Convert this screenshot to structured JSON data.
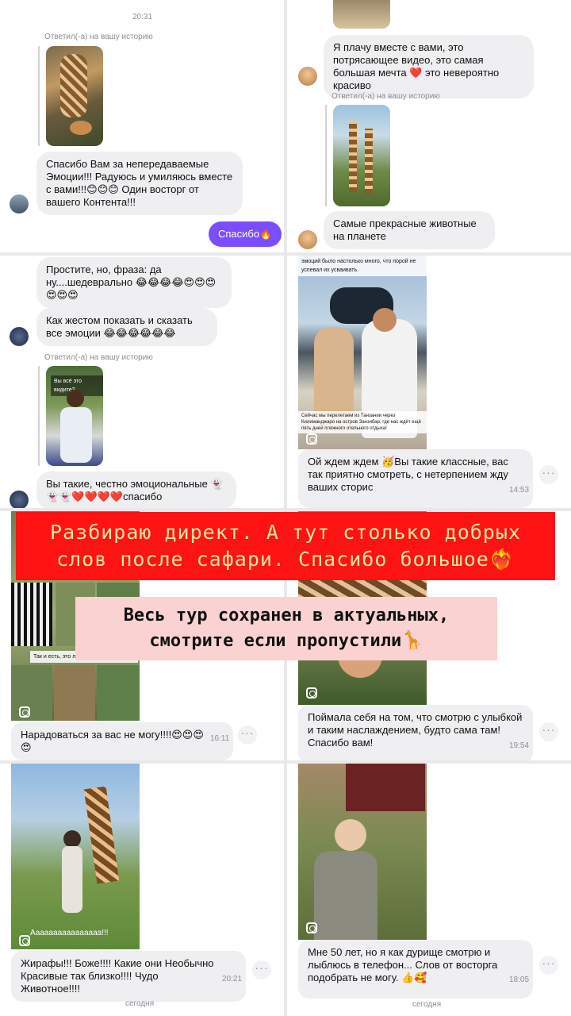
{
  "p1": {
    "time_top": "20:31",
    "reply_label_1": "Ответил(-а) на вашу историю",
    "msg1": "Спасибо Вам за непередаваемые Эмоции!!! Радуюсь и умиляюсь вместе с вами!!!😊😊😊 Один восторг от вашего Контента!!!",
    "sent": "Спасибо🔥"
  },
  "p2": {
    "msg1": "Я плачу вместе с вами, это потрясающее видео, это самая большая мечта ❤️  это невероятно красиво",
    "reply_label": "Ответил(-а) на вашу историю",
    "msg2": "Самые прекрасные животные на планете"
  },
  "p3": {
    "msg1": "Простите, но, фраза: да ну....шедеврально 😂😂😂😂😍😍😍😍😍😍",
    "msg2": "Как жестом показать и сказать все эмоции 😂😂😂😂😂😂",
    "reply_label": "Ответил(-а) на вашу историю",
    "thumb_caption": "Вы всё это видите?",
    "msg3": "Вы такие, честно эмоциональные 👻👻👻❤️❤️❤️❤️спасибо"
  },
  "p4": {
    "story_top": "эмоций было настолько много, что порой не успевал их усваивать.",
    "story_bottom": "Сейчас мы перелетаем из Танзании через Килиманджаро на остров Занзибар, где нас ждёт ещё пять дней пляжного отельного отдыха!",
    "msg": "Ой ждем ждем 🥳Вы такие классные, вас так приятно смотреть, с нетерпением жду ваших сторис",
    "time": "14:53"
  },
  "banner": {
    "red_text": "Разбираю директ. А тут столько добрых слов после сафари. Спасибо большое❤️‍🔥",
    "pink_text": "Весь тур сохранен в актуальных, смотрите если пропустили🦒"
  },
  "p5": {
    "story_caption": "Так и есть, это лучшие ... в жизни, но ...",
    "msg": "Нарадоваться за вас не могу!!!!😍😍😍😍",
    "time": "16:11"
  },
  "p6": {
    "msg": "Поймала себя на том, что смотрю с улыбкой и таким наслаждением, будто сама там! Спасибо вам!",
    "time": "19:54"
  },
  "p7": {
    "story_caption": "Аааааааааааааааа!!!",
    "msg": "Жирафы!!! Боже!!!! Какие они Необычно Красивые так близко!!!! Чудо Животное!!!!",
    "time": "20:21",
    "day": "сегодня"
  },
  "p8": {
    "msg": "Мне 50 лет, но я как дурище смотрю и лыблюсь в телефон... Слов от восторга подобрать не могу. 👍🥰",
    "time": "18:05",
    "day": "сегодня"
  },
  "icons": {
    "more": "more-dots-icon",
    "instagram": "instagram-icon"
  },
  "colors": {
    "sent_bubble": "#7c4dff",
    "banner_red": "#ff1212",
    "banner_pink": "#fbd2d2"
  }
}
